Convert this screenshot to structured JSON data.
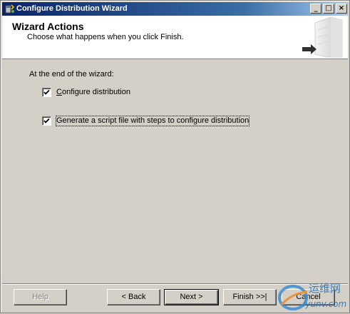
{
  "window": {
    "title": "Configure Distribution Wizard",
    "controls": {
      "minimize": "_",
      "maximize": "□",
      "close": "×"
    }
  },
  "header": {
    "title": "Wizard Actions",
    "subtitle": "Choose what happens when you click Finish."
  },
  "content": {
    "intro": "At the end of the wizard:",
    "options": [
      {
        "label": "Configure distribution",
        "checked": true
      },
      {
        "label": "Generate a script file with steps to configure distribution",
        "checked": true
      }
    ]
  },
  "buttons": {
    "help": {
      "label": "Help",
      "enabled": false
    },
    "back": {
      "label": "< Back",
      "enabled": true
    },
    "next": {
      "label": "Next >",
      "enabled": true
    },
    "finish": {
      "label": "Finish >>|",
      "enabled": true
    },
    "cancel": {
      "label": "Cancel",
      "enabled": true
    }
  },
  "watermark": {
    "text_cn": "运维网",
    "text_url": "iyunv.com"
  },
  "colors": {
    "titlebar_start": "#0a246a",
    "titlebar_end": "#a6caf0",
    "face": "#d4d0c8",
    "header_bg": "#ffffff"
  }
}
